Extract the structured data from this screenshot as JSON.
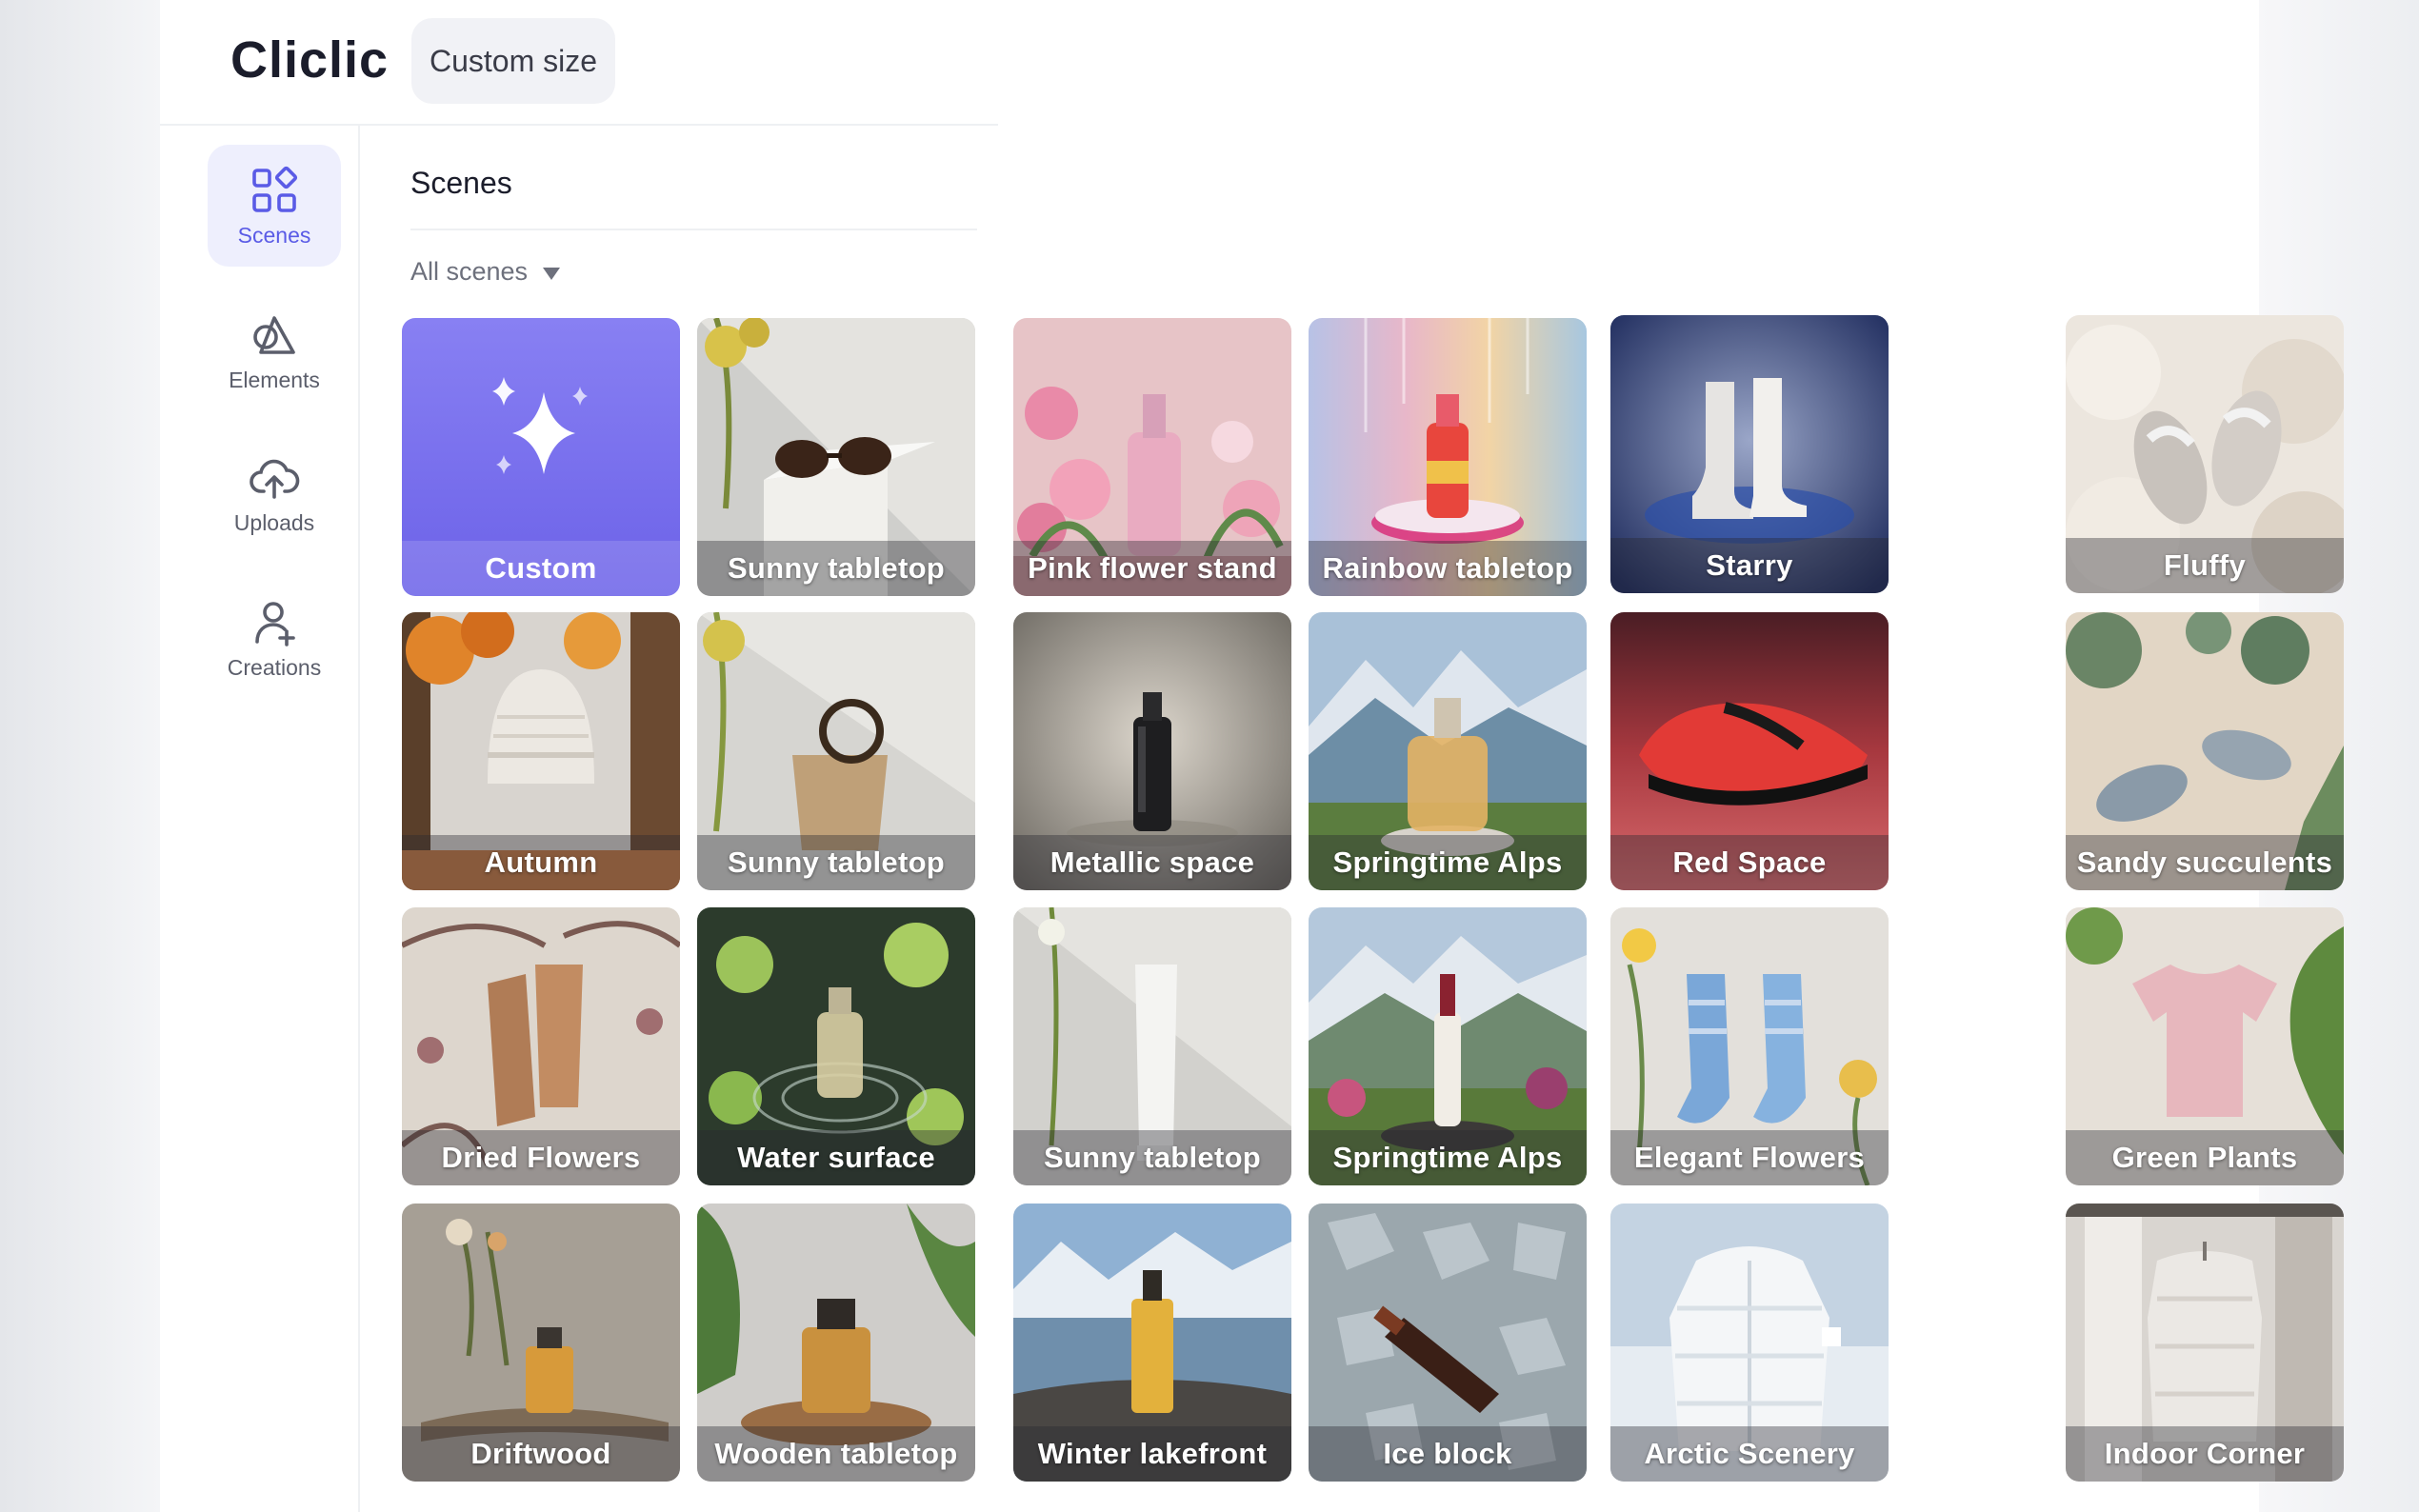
{
  "app": {
    "logo": "Cliclic",
    "custom_size_label": "Custom size"
  },
  "sidebar": {
    "items": [
      {
        "label": "Scenes",
        "icon": "grid-icon",
        "active": true
      },
      {
        "label": "Elements",
        "icon": "shapes-icon",
        "active": false
      },
      {
        "label": "Uploads",
        "icon": "cloud-upload-icon",
        "active": false
      },
      {
        "label": "Creations",
        "icon": "user-icon",
        "active": false
      }
    ]
  },
  "main": {
    "title": "Scenes",
    "filter": "All scenes"
  },
  "scenes": [
    {
      "label": "Custom",
      "icon": "sparkle-icon"
    },
    {
      "label": "Sunny tabletop"
    },
    {
      "label": "Pink flower stand"
    },
    {
      "label": "Rainbow tabletop"
    },
    {
      "label": "Starry"
    },
    {
      "label": "Fluffy"
    },
    {
      "label": "Autumn"
    },
    {
      "label": "Sunny tabletop"
    },
    {
      "label": "Metallic space"
    },
    {
      "label": "Springtime Alps"
    },
    {
      "label": "Red Space"
    },
    {
      "label": "Sandy succulents"
    },
    {
      "label": "Dried Flowers"
    },
    {
      "label": "Water surface"
    },
    {
      "label": "Sunny tabletop"
    },
    {
      "label": "Springtime Alps"
    },
    {
      "label": "Elegant Flowers"
    },
    {
      "label": "Green Plants"
    },
    {
      "label": "Driftwood"
    },
    {
      "label": "Wooden tabletop"
    },
    {
      "label": "Winter lakefront"
    },
    {
      "label": "Ice block"
    },
    {
      "label": "Arctic Scenery"
    },
    {
      "label": "Indoor Corner"
    }
  ],
  "colors": {
    "accent": "#5a5be6",
    "custom_tile": "#7b74ee"
  }
}
